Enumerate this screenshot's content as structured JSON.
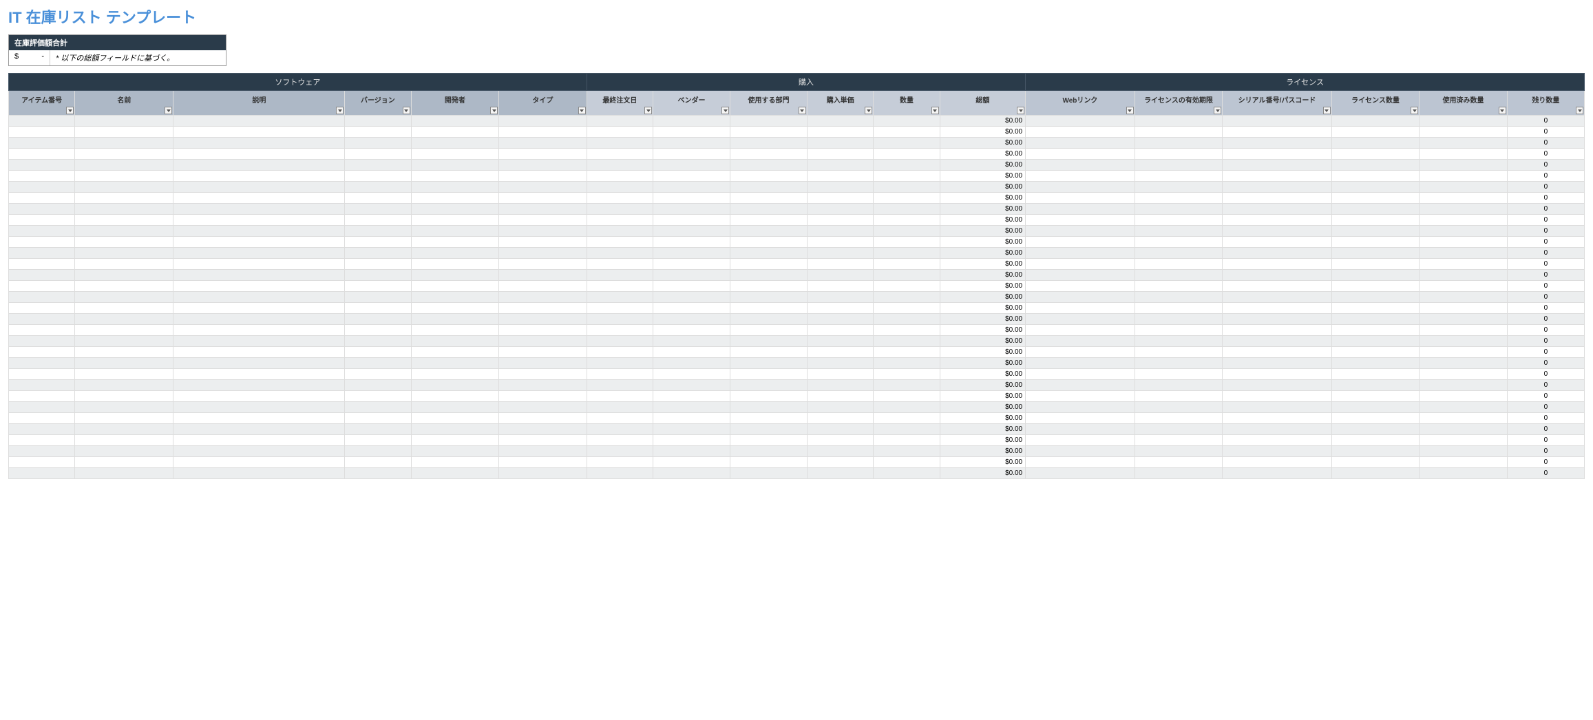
{
  "title": "IT 在庫リスト テンプレート",
  "summary": {
    "header": "在庫評価額合計",
    "currency": "$",
    "value": "-",
    "note": "* 以下の総額フィールドに基づく。"
  },
  "groups": {
    "software": "ソフトウェア",
    "purchase": "購入",
    "license": "ライセンス"
  },
  "columns": {
    "item_no": "アイテム番号",
    "name": "名前",
    "description": "説明",
    "version": "バージョン",
    "developer": "開発者",
    "type": "タイプ",
    "last_order_date": "最終注文日",
    "vendor": "ベンダー",
    "department": "使用する部門",
    "unit_price": "購入単価",
    "quantity": "数量",
    "total": "総額",
    "web_link": "Webリンク",
    "license_expiry": "ライセンスの有効期限",
    "serial": "シリアル番号/パスコード",
    "license_qty": "ライセンス数量",
    "used_qty": "使用済み数量",
    "remaining_qty": "残り数量"
  },
  "row_count": 33,
  "default_total": "$0.00",
  "default_remaining": "0"
}
